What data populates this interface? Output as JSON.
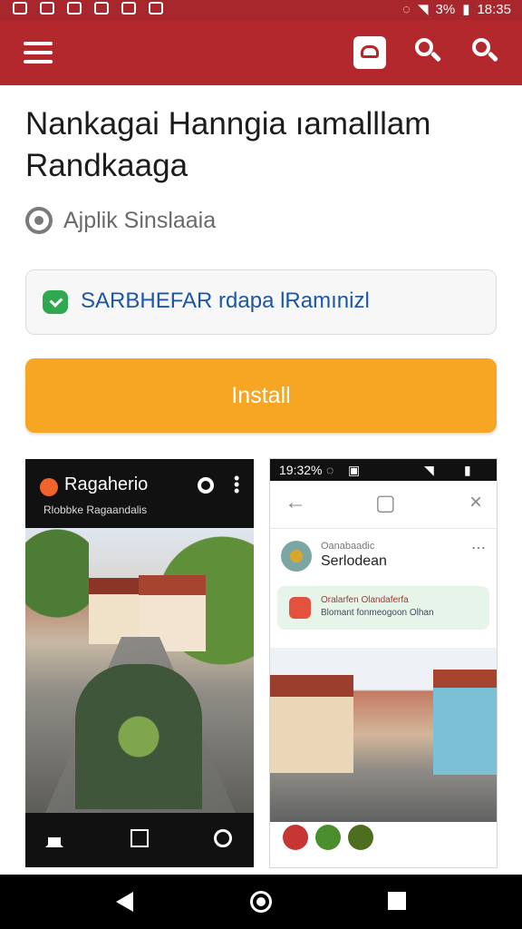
{
  "statusbar": {
    "battery": "3%",
    "time": "18:35"
  },
  "app": {
    "title": "Nankagai Hanngia ıamalllam Randkaaga",
    "developer": "Ajplik Sinslaaia",
    "badge": "SARBHEFAR rdapa lRamınizl",
    "install": "Install"
  },
  "screens": {
    "left": {
      "title": "Ragaherio",
      "subtitle": "Rlobbke Ragaandalis"
    },
    "right": {
      "status_left": "19:32%",
      "small": "Oanabaadic",
      "name": "Serlodean",
      "notice1": "Oralarfen Olandaferfa",
      "notice2": "Blomant fonmeogoon Olhan"
    }
  },
  "icons": {
    "menu": "menu-icon",
    "phone": "phone-icon",
    "search": "search-icon",
    "developer": "developer-icon",
    "badge": "chat-icon"
  },
  "colors": {
    "appbar": "#b3282d",
    "install": "#f6a623",
    "badge_text": "#1a57a8"
  }
}
